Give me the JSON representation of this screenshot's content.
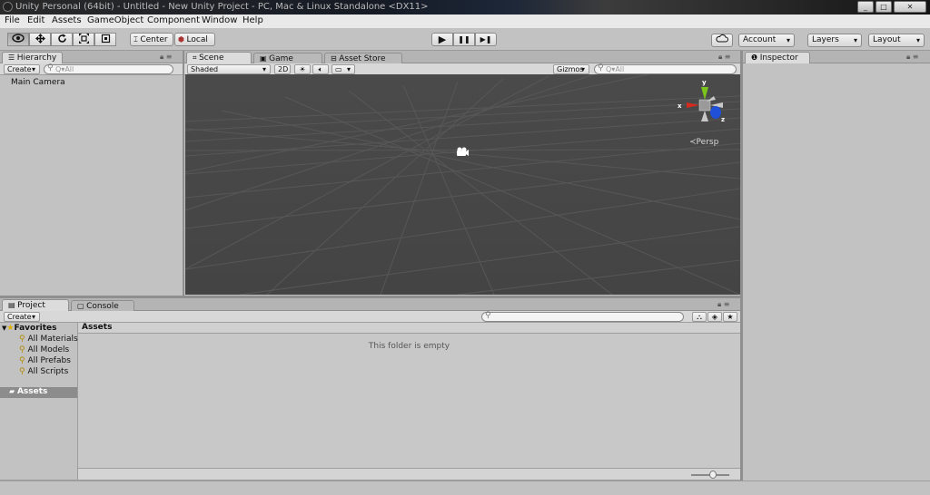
{
  "window": {
    "title": "Unity Personal (64bit) - Untitled - New Unity Project - PC, Mac & Linux Standalone <DX11>",
    "controls": {
      "minimize": "_",
      "maximize": "□",
      "close": "✕"
    }
  },
  "menu": {
    "items": [
      "File",
      "Edit",
      "Assets",
      "GameObject",
      "Component",
      "Window",
      "Help"
    ]
  },
  "toolbar": {
    "tools": [
      "hand-icon",
      "move-icon",
      "rotate-icon",
      "scale-icon",
      "rect-icon"
    ],
    "pivot_label": "Center",
    "space_label": "Local",
    "play_icon": "▶",
    "pause_icon": "❚❚",
    "step_icon": "▶❚",
    "account_label": "Account",
    "layers_label": "Layers",
    "layout_label": "Layout"
  },
  "hierarchy": {
    "tab_label": "Hierarchy",
    "create_label": "Create",
    "search_placeholder": "Q▾All",
    "items": [
      "Main Camera"
    ]
  },
  "scene": {
    "tabs": [
      "Scene",
      "Game",
      "Asset Store"
    ],
    "shading_mode": "Shaded",
    "mode_2d": "2D",
    "gizmos_label": "Gizmos",
    "search_placeholder": "Q▾All",
    "persp_label": "Persp",
    "axis_labels": {
      "x": "x",
      "y": "y",
      "z": "z"
    }
  },
  "inspector": {
    "tab_label": "Inspector"
  },
  "project": {
    "tabs": [
      "Project",
      "Console"
    ],
    "create_label": "Create",
    "favorites_label": "Favorites",
    "favorites": [
      "All Materials",
      "All Models",
      "All Prefabs",
      "All Scripts"
    ],
    "assets_label": "Assets",
    "breadcrumb": "Assets",
    "empty_message": "This folder is empty"
  },
  "colors": {
    "scene_bg": "#474747",
    "grid_line": "#5a5a5a",
    "axis_x": "#d62a1e",
    "axis_y": "#7ac41c",
    "axis_z": "#2050d8",
    "selected_row": "#8c8c8c"
  }
}
